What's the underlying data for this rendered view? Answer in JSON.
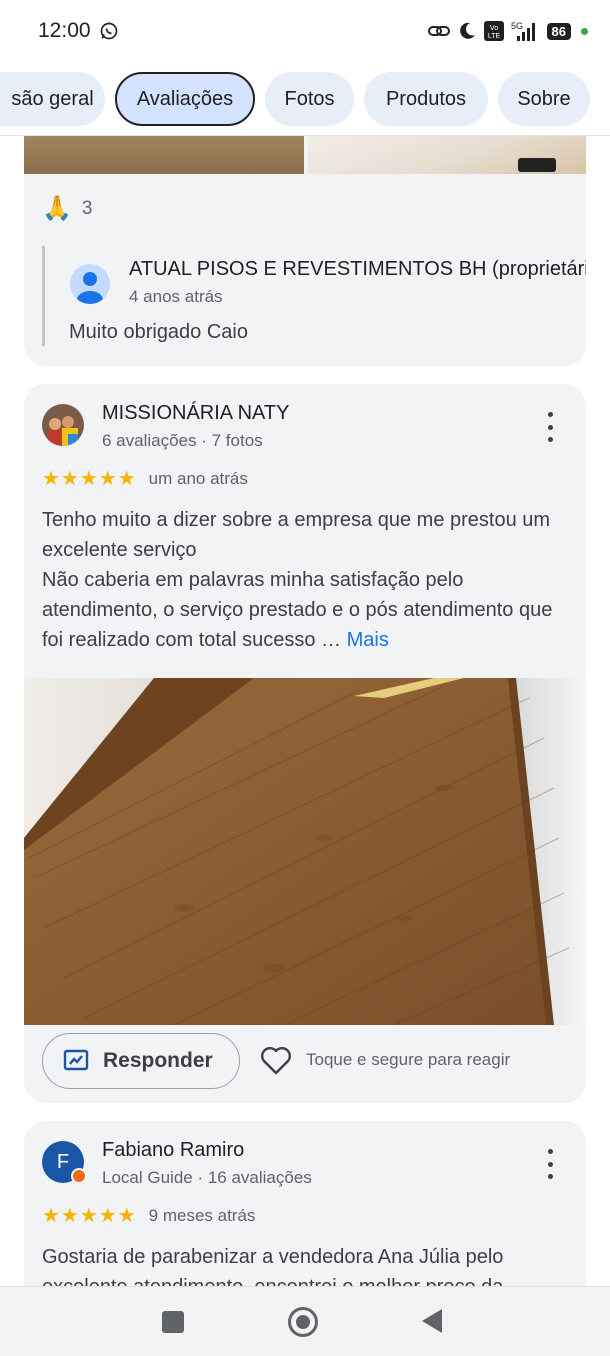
{
  "status_bar": {
    "time": "12:00",
    "network": "5G",
    "volte": "Vo LTE",
    "battery": "86"
  },
  "tabs": [
    {
      "label": "são geral",
      "active": false
    },
    {
      "label": "Avaliações",
      "active": true
    },
    {
      "label": "Fotos",
      "active": false
    },
    {
      "label": "Produtos",
      "active": false
    },
    {
      "label": "Sobre",
      "active": false
    }
  ],
  "prev_review": {
    "reaction_emoji": "🙏",
    "reaction_count": "3",
    "owner_reply": {
      "name": "ATUAL PISOS E REVESTIMENTOS BH (proprietário)",
      "time": "4 anos atrás",
      "text": "Muito obrigado Caio"
    }
  },
  "review_naty": {
    "author": "MISSIONÁRIA NATY",
    "meta": "6 avaliações · 7 fotos",
    "stars": "★★★★★",
    "rating": 5,
    "time": "um ano atrás",
    "text": "Tenho muito a dizer sobre a empresa que me prestou um excelente serviço\nNão caberia em palavras minha satisfação pelo atendimento, o serviço prestado e o pós atendimento que foi realizado com total sucesso … ",
    "more_label": "Mais",
    "respond_label": "Responder",
    "react_hint": "Toque e segure para reagir"
  },
  "review_fabiano": {
    "avatar_letter": "F",
    "author": "Fabiano Ramiro",
    "meta": "Local Guide · 16 avaliações",
    "stars": "★★★★★",
    "rating": 5,
    "time": "9 meses atrás",
    "text": "Gostaria de parabenizar a vendedora Ana Júlia pelo excelente atendimento, encontrei o melhor preço da"
  },
  "colors": {
    "accent": "#1a73e8",
    "star": "#f4b400",
    "active_tab": "#d3e3fd",
    "card_bg": "#f1f3f4"
  }
}
